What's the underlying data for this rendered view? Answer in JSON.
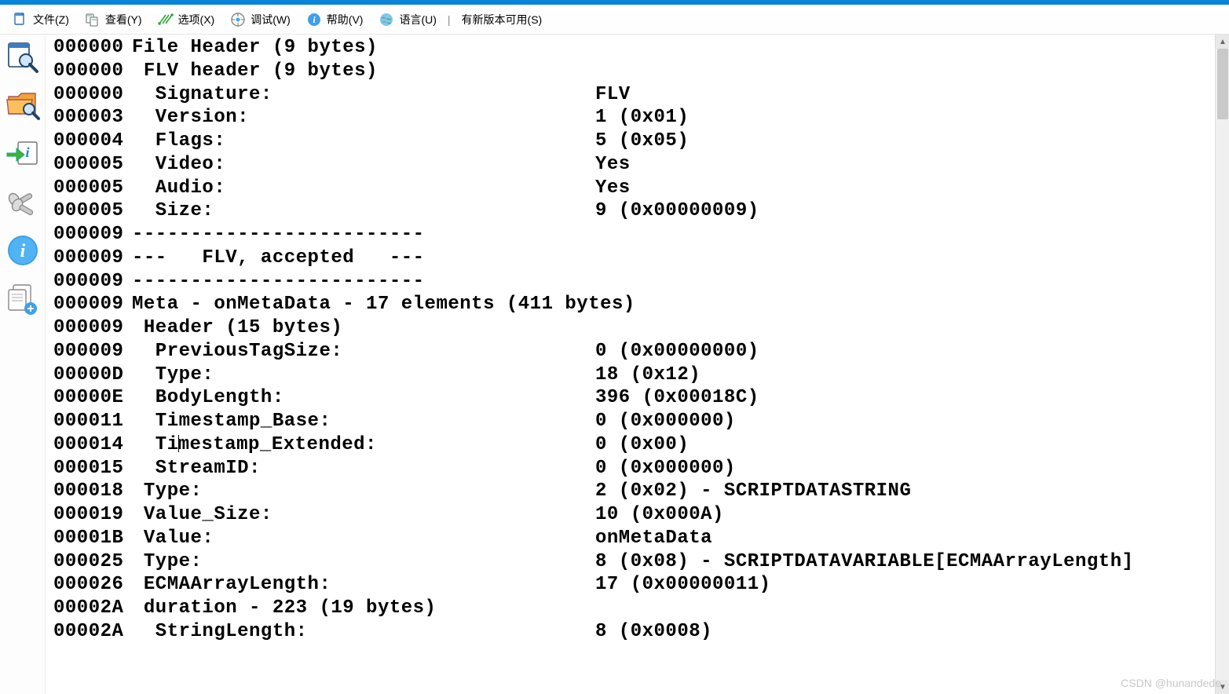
{
  "menubar": {
    "file": {
      "label": "文件(Z)"
    },
    "view": {
      "label": "查看(Y)"
    },
    "options": {
      "label": "选项(X)"
    },
    "debug": {
      "label": "调试(W)"
    },
    "help": {
      "label": "帮助(V)"
    },
    "lang": {
      "label": "语言(U)"
    },
    "update": {
      "label": "有新版本可用(S)"
    }
  },
  "rows": [
    {
      "addr": "000000",
      "ind": 0,
      "label": "File Header (9 bytes)",
      "val": ""
    },
    {
      "addr": "000000",
      "ind": 1,
      "label": "FLV header (9 bytes)",
      "val": ""
    },
    {
      "addr": "000000",
      "ind": 2,
      "label": "Signature:",
      "val": "FLV"
    },
    {
      "addr": "000003",
      "ind": 2,
      "label": "Version:",
      "val": "1 (0x01)"
    },
    {
      "addr": "000004",
      "ind": 2,
      "label": "Flags:",
      "val": "5 (0x05)"
    },
    {
      "addr": "000005",
      "ind": 2,
      "label": "Video:",
      "val": "Yes"
    },
    {
      "addr": "000005",
      "ind": 2,
      "label": "Audio:",
      "val": "Yes"
    },
    {
      "addr": "000005",
      "ind": 2,
      "label": "Size:",
      "val": "9 (0x00000009)"
    },
    {
      "addr": "000009",
      "ind": 0,
      "label": "-------------------------",
      "val": ""
    },
    {
      "addr": "000009",
      "ind": 0,
      "label": "---   FLV, accepted   ---",
      "val": ""
    },
    {
      "addr": "000009",
      "ind": 0,
      "label": "-------------------------",
      "val": ""
    },
    {
      "addr": "000009",
      "ind": 0,
      "label": "Meta - onMetaData - 17 elements (411 bytes)",
      "val": ""
    },
    {
      "addr": "000009",
      "ind": 1,
      "label": "Header (15 bytes)",
      "val": ""
    },
    {
      "addr": "000009",
      "ind": 2,
      "label": "PreviousTagSize:",
      "val": "0 (0x00000000)"
    },
    {
      "addr": "00000D",
      "ind": 2,
      "label": "Type:",
      "val": "18 (0x12)"
    },
    {
      "addr": "00000E",
      "ind": 2,
      "label": "BodyLength:",
      "val": "396 (0x00018C)"
    },
    {
      "addr": "000011",
      "ind": 2,
      "label": "Timestamp_Base:",
      "val": "0 (0x000000)"
    },
    {
      "addr": "000014",
      "ind": 2,
      "label": "Timestamp_Extended:",
      "val": "0 (0x00)",
      "cursor": 2
    },
    {
      "addr": "000015",
      "ind": 2,
      "label": "StreamID:",
      "val": "0 (0x000000)"
    },
    {
      "addr": "000018",
      "ind": 1,
      "label": "Type:",
      "val": "2 (0x02) - SCRIPTDATASTRING"
    },
    {
      "addr": "000019",
      "ind": 1,
      "label": "Value_Size:",
      "val": "10 (0x000A)"
    },
    {
      "addr": "00001B",
      "ind": 1,
      "label": "Value:",
      "val": "onMetaData"
    },
    {
      "addr": "000025",
      "ind": 1,
      "label": "Type:",
      "val": "8 (0x08) - SCRIPTDATAVARIABLE[ECMAArrayLength]"
    },
    {
      "addr": "000026",
      "ind": 1,
      "label": "ECMAArrayLength:",
      "val": "17 (0x00000011)"
    },
    {
      "addr": "00002A",
      "ind": 1,
      "label": "duration - 223 (19 bytes)",
      "val": ""
    },
    {
      "addr": "00002A",
      "ind": 2,
      "label": "StringLength:",
      "val": "8 (0x0008)"
    }
  ],
  "watermark": "CSDN @hunandede"
}
